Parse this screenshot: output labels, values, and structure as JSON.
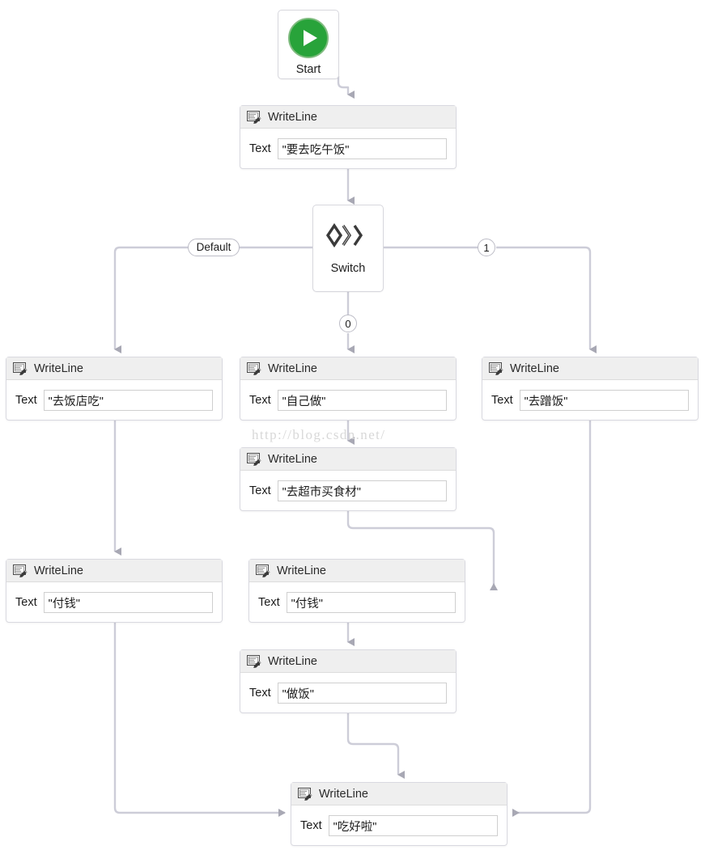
{
  "diagram": {
    "title": "Workflow Designer Canvas",
    "colors": {
      "connector": "#cdcdd8",
      "arrowhead": "#a8a8b4",
      "node_border": "#d9d9e0",
      "header_bg": "#efefef",
      "start_green": "#28a33a",
      "watermark": "#d8d8d8",
      "canvas_bg": "#ffffff"
    },
    "watermark": "http://blog.csdn.net/",
    "start": {
      "label": "Start",
      "icon": "play-icon"
    },
    "switch": {
      "label": "Switch",
      "icon": "switch-diamonds-icon"
    },
    "edge_labels": {
      "default": "Default",
      "case_zero": "0",
      "case_one": "1"
    },
    "field_label": "Text",
    "activity_type": "WriteLine",
    "nodes": [
      {
        "id": "wl-lunch",
        "type": "WriteLine",
        "field": "Text",
        "value": "\"要去吃午饭\""
      },
      {
        "id": "wl-restaurant",
        "type": "WriteLine",
        "field": "Text",
        "value": "\"去饭店吃\""
      },
      {
        "id": "wl-cook-self",
        "type": "WriteLine",
        "field": "Text",
        "value": "\"自己做\""
      },
      {
        "id": "wl-mooch",
        "type": "WriteLine",
        "field": "Text",
        "value": "\"去蹭饭\""
      },
      {
        "id": "wl-groceries",
        "type": "WriteLine",
        "field": "Text",
        "value": "\"去超市买食材\""
      },
      {
        "id": "wl-pay-left",
        "type": "WriteLine",
        "field": "Text",
        "value": "\"付钱\""
      },
      {
        "id": "wl-pay-mid",
        "type": "WriteLine",
        "field": "Text",
        "value": "\"付钱\""
      },
      {
        "id": "wl-cook",
        "type": "WriteLine",
        "field": "Text",
        "value": "\"做饭\""
      },
      {
        "id": "wl-done",
        "type": "WriteLine",
        "field": "Text",
        "value": "\"吃好啦\""
      }
    ]
  }
}
